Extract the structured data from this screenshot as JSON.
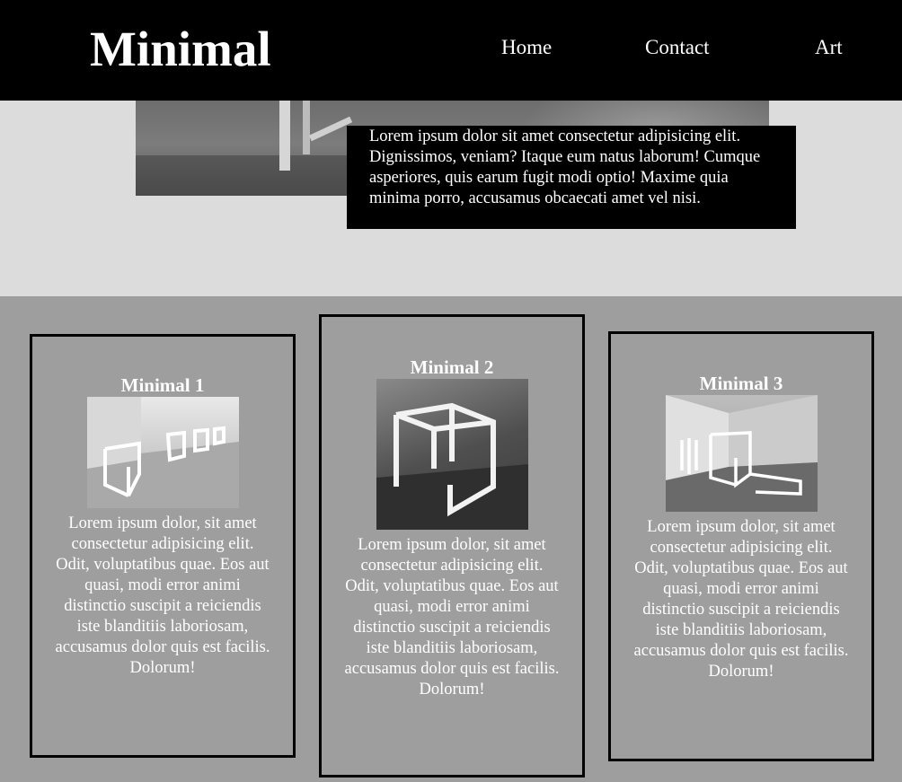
{
  "header": {
    "logo": "Minimal",
    "nav": [
      "Home",
      "Contact",
      "Art"
    ]
  },
  "hero": {
    "text": "Lorem ipsum dolor sit amet consectetur adipisicing elit. Dignissimos, veniam? Itaque eum natus laborum! Cumque asperiores, quis earum fugit modi optio! Maxime quia minima porro, accusamus obcaecati amet vel nisi."
  },
  "cards": [
    {
      "title": "Minimal 1",
      "text": "Lorem ipsum dolor, sit amet consectetur adipisicing elit. Odit, voluptatibus quae. Eos aut quasi, modi error animi distinctio suscipit a reiciendis iste blanditiis laboriosam, accusamus dolor quis est facilis. Dolorum!"
    },
    {
      "title": "Minimal 2",
      "text": "Lorem ipsum dolor, sit amet consectetur adipisicing elit. Odit, voluptatibus quae. Eos aut quasi, modi error animi distinctio suscipit a reiciendis iste blanditiis laboriosam, accusamus dolor quis est facilis. Dolorum!"
    },
    {
      "title": "Minimal 3",
      "text": "Lorem ipsum dolor, sit amet consectetur adipisicing elit. Odit, voluptatibus quae. Eos aut quasi, modi error animi distinctio suscipit a reiciendis iste blanditiis laboriosam, accusamus dolor quis est facilis. Dolorum!"
    }
  ],
  "colors": {
    "header_bg": "#000000",
    "hero_bg": "#dcdcdc",
    "page_bg": "#9e9e9e",
    "text": "#ffffff"
  }
}
